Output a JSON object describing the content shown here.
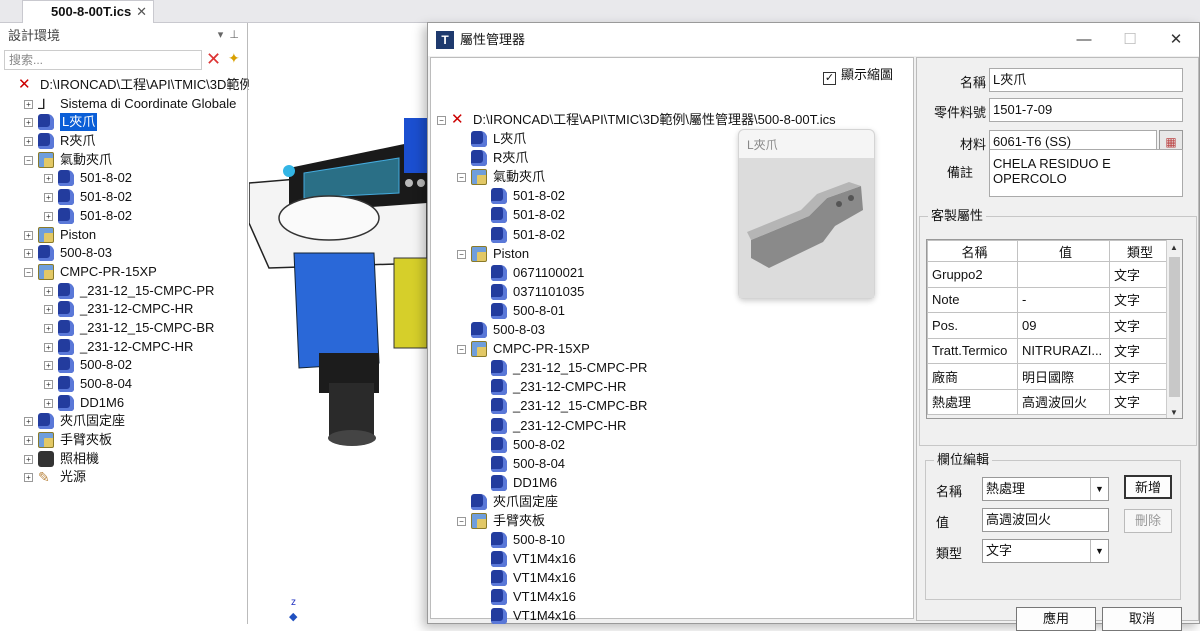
{
  "tab": {
    "title": "500-8-00T.ics",
    "close": "✕"
  },
  "left_panel": {
    "title": "設計環境",
    "search_placeholder": "搜索...",
    "tree": [
      {
        "label": "D:\\IRONCAD\\工程\\API\\TMIC\\3D範例",
        "icon": "root",
        "level": 0,
        "exp": ""
      },
      {
        "label": "Sistema di Coordinate Globale",
        "icon": "coord",
        "level": 1,
        "exp": "+"
      },
      {
        "label": "L夾爪",
        "icon": "part",
        "level": 1,
        "exp": "+",
        "selected": true
      },
      {
        "label": "R夾爪",
        "icon": "part",
        "level": 1,
        "exp": "+"
      },
      {
        "label": "氣動夾爪",
        "icon": "asm",
        "level": 1,
        "exp": "−"
      },
      {
        "label": "501-8-02",
        "icon": "part",
        "level": 2,
        "exp": "+"
      },
      {
        "label": "501-8-02",
        "icon": "part",
        "level": 2,
        "exp": "+"
      },
      {
        "label": "501-8-02",
        "icon": "part",
        "level": 2,
        "exp": "+"
      },
      {
        "label": "Piston",
        "icon": "asm",
        "level": 1,
        "exp": "+"
      },
      {
        "label": "500-8-03",
        "icon": "part",
        "level": 1,
        "exp": "+"
      },
      {
        "label": "CMPC-PR-15XP",
        "icon": "asm",
        "level": 1,
        "exp": "−"
      },
      {
        "label": "_231-12_15-CMPC-PR",
        "icon": "part",
        "level": 2,
        "exp": "+"
      },
      {
        "label": "_231-12-CMPC-HR",
        "icon": "part",
        "level": 2,
        "exp": "+"
      },
      {
        "label": "_231-12_15-CMPC-BR",
        "icon": "part",
        "level": 2,
        "exp": "+"
      },
      {
        "label": "_231-12-CMPC-HR",
        "icon": "part",
        "level": 2,
        "exp": "+"
      },
      {
        "label": "500-8-02",
        "icon": "part",
        "level": 2,
        "exp": "+"
      },
      {
        "label": "500-8-04",
        "icon": "part",
        "level": 2,
        "exp": "+"
      },
      {
        "label": "DD1M6",
        "icon": "part",
        "level": 2,
        "exp": "+"
      },
      {
        "label": "夾爪固定座",
        "icon": "part",
        "level": 1,
        "exp": "+"
      },
      {
        "label": "手臂夾板",
        "icon": "asm",
        "level": 1,
        "exp": "+"
      },
      {
        "label": "照相機",
        "icon": "cam",
        "level": 1,
        "exp": "+"
      },
      {
        "label": "光源",
        "icon": "light",
        "level": 1,
        "exp": "+"
      }
    ]
  },
  "viewport": {
    "axis_label": "z"
  },
  "dialog": {
    "title": "屬性管理器",
    "show_preview": "顯示縮圖",
    "minimize": "—",
    "maximize": "☐",
    "close": "✕",
    "tree": [
      {
        "label": "D:\\IRONCAD\\工程\\API\\TMIC\\3D範例\\屬性管理器\\500-8-00T.ics",
        "icon": "root",
        "level": 0,
        "exp": "−"
      },
      {
        "label": "L夾爪",
        "icon": "part",
        "level": 1
      },
      {
        "label": "R夾爪",
        "icon": "part",
        "level": 1
      },
      {
        "label": "氣動夾爪",
        "icon": "asm",
        "level": 1,
        "exp": "−"
      },
      {
        "label": "501-8-02",
        "icon": "part",
        "level": 2
      },
      {
        "label": "501-8-02",
        "icon": "part",
        "level": 2
      },
      {
        "label": "501-8-02",
        "icon": "part",
        "level": 2
      },
      {
        "label": "Piston",
        "icon": "asm",
        "level": 1,
        "exp": "−"
      },
      {
        "label": "0671100021",
        "icon": "part",
        "level": 2
      },
      {
        "label": "0371101035",
        "icon": "part",
        "level": 2
      },
      {
        "label": "500-8-01",
        "icon": "part",
        "level": 2
      },
      {
        "label": "500-8-03",
        "icon": "part",
        "level": 1
      },
      {
        "label": "CMPC-PR-15XP",
        "icon": "asm",
        "level": 1,
        "exp": "−"
      },
      {
        "label": "_231-12_15-CMPC-PR",
        "icon": "part",
        "level": 2
      },
      {
        "label": "_231-12-CMPC-HR",
        "icon": "part",
        "level": 2
      },
      {
        "label": "_231-12_15-CMPC-BR",
        "icon": "part",
        "level": 2
      },
      {
        "label": "_231-12-CMPC-HR",
        "icon": "part",
        "level": 2
      },
      {
        "label": "500-8-02",
        "icon": "part",
        "level": 2
      },
      {
        "label": "500-8-04",
        "icon": "part",
        "level": 2
      },
      {
        "label": "DD1M6",
        "icon": "part",
        "level": 2
      },
      {
        "label": "夾爪固定座",
        "icon": "part",
        "level": 1
      },
      {
        "label": "手臂夾板",
        "icon": "asm",
        "level": 1,
        "exp": "−"
      },
      {
        "label": "500-8-10",
        "icon": "part",
        "level": 2
      },
      {
        "label": "VT1M4x16",
        "icon": "part",
        "level": 2
      },
      {
        "label": "VT1M4x16",
        "icon": "part",
        "level": 2
      },
      {
        "label": "VT1M4x16",
        "icon": "part",
        "level": 2
      },
      {
        "label": "VT1M4x16",
        "icon": "part",
        "level": 2
      }
    ],
    "preview_label": "L夾爪",
    "props": {
      "name_label": "名稱",
      "name": "L夾爪",
      "partno_label": "零件料號",
      "partno": "1501-7-09",
      "material_label": "材料",
      "material": "6061-T6 (SS)",
      "remark_label": "備註",
      "remark": "CHELA RESIDUO E OPERCOLO"
    },
    "custom": {
      "title": "客製屬性",
      "headers": [
        "名稱",
        "值",
        "類型"
      ],
      "rows": [
        [
          "Gruppo2",
          "",
          "文字"
        ],
        [
          "Note",
          "-",
          "文字"
        ],
        [
          "Pos.",
          "09",
          "文字"
        ],
        [
          "Tratt.Termico",
          "NITRURAZI...",
          "文字"
        ],
        [
          "廠商",
          "明日國際",
          "文字"
        ],
        [
          "熱處理",
          "高週波回火",
          "文字"
        ]
      ]
    },
    "edit": {
      "title": "欄位編輯",
      "name_label": "名稱",
      "name_value": "熱處理",
      "value_label": "值",
      "value": "高週波回火",
      "type_label": "類型",
      "type_value": "文字",
      "add": "新增",
      "delete": "刪除"
    },
    "apply": "應用",
    "cancel": "取消"
  }
}
